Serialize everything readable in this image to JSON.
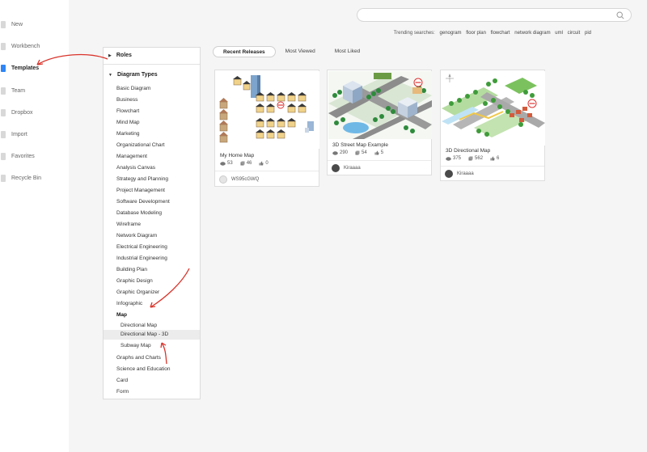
{
  "nav": {
    "items": [
      {
        "label": "New",
        "icon": "plus-icon"
      },
      {
        "label": "Workbench",
        "icon": "home-icon"
      },
      {
        "label": "Templates",
        "icon": "template-icon",
        "active": true
      },
      {
        "label": "Team",
        "icon": "team-icon"
      },
      {
        "label": "Dropbox",
        "icon": "dropbox-icon"
      },
      {
        "label": "Import",
        "icon": "import-icon"
      },
      {
        "label": "Favorites",
        "icon": "star-icon"
      },
      {
        "label": "Recycle Bin",
        "icon": "trash-icon"
      }
    ]
  },
  "search": {
    "placeholder": "",
    "value": ""
  },
  "trending": {
    "label": "Trending searches:",
    "terms": [
      "genogram",
      "floor plan",
      "flowchart",
      "network diagram",
      "uml",
      "circuit",
      "pid"
    ]
  },
  "categories": {
    "roles_label": "Roles",
    "diagram_types_label": "Diagram Types",
    "items": [
      "Basic Diagram",
      "Business",
      "Flowchart",
      "Mind Map",
      "Marketing",
      "Organizational Chart",
      "Management",
      "Analysis Canvas",
      "Strategy and Planning",
      "Project Management",
      "Software Development",
      "Database Modeling",
      "Wireframe",
      "Network Diagram",
      "Electrical Engineering",
      "Industrial Engineering",
      "Building Plan",
      "Graphic Design",
      "Graphic Organizer",
      "Infographic"
    ],
    "map_label": "Map",
    "map_subs": [
      "Directional Map",
      "Directional Map - 3D",
      "Subway Map"
    ],
    "selected_sub": "Directional Map - 3D",
    "after_items": [
      "Graphs and Charts",
      "Science and Education",
      "Card",
      "Form"
    ]
  },
  "tabs": [
    "Recent Releases",
    "Most Viewed",
    "Most Liked"
  ],
  "active_tab": "Recent Releases",
  "cards": [
    {
      "title": "My Home Map",
      "views": "53",
      "copies": "46",
      "likes": "0",
      "author": "WS95cGWQ"
    },
    {
      "title": "3D Street Map Example",
      "views": "290",
      "copies": "54",
      "likes": "5",
      "author": "Kiraaaa"
    },
    {
      "title": "3D Directional Map",
      "views": "375",
      "copies": "562",
      "likes": "6",
      "author": "Kiraaaa"
    }
  ],
  "colors": {
    "accent": "#2f86f6",
    "annotation": "#d9342b"
  }
}
